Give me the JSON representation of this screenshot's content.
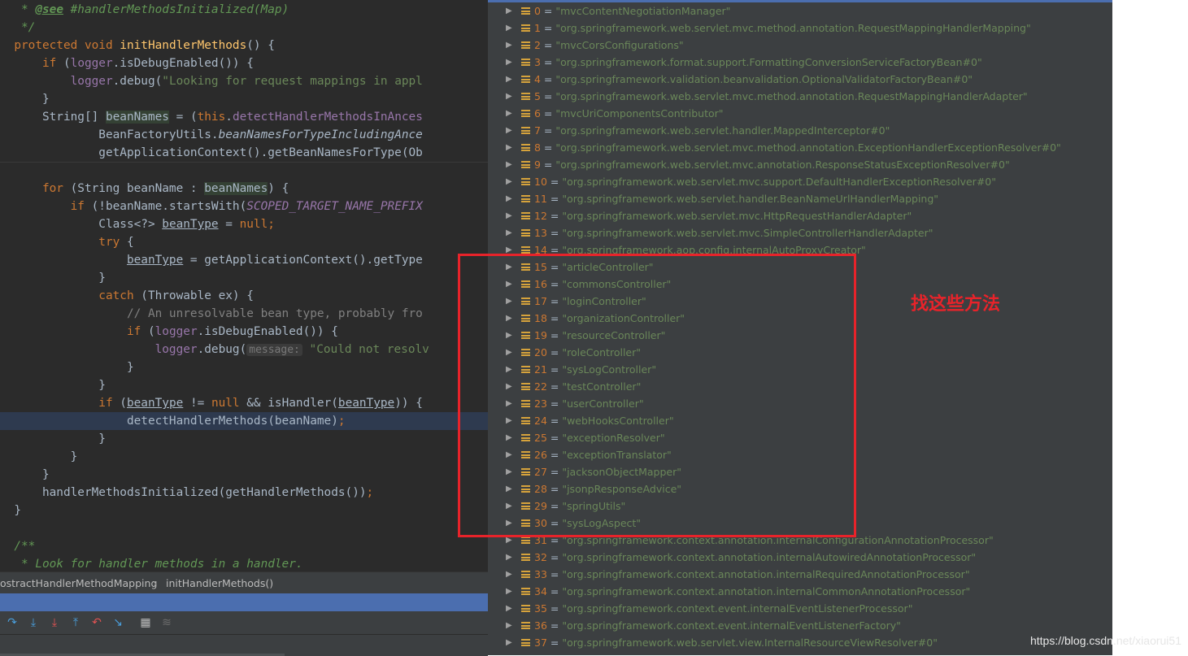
{
  "editor": {
    "lines": [
      [
        {
          "t": "   * ",
          "c": "c-doc"
        },
        {
          "t": "@see",
          "c": "c-doctag"
        },
        {
          "t": " #handlerMethodsInitialized(Map)",
          "c": "c-doc"
        }
      ],
      [
        {
          "t": "   */",
          "c": "c-doc"
        }
      ],
      [
        {
          "t": "  protected void ",
          "c": "c-kw"
        },
        {
          "t": "initHandlerMethods",
          "c": "c-fn"
        },
        {
          "t": "() {",
          "c": ""
        }
      ],
      [
        {
          "t": "      if ",
          "c": "c-kw"
        },
        {
          "t": "(",
          "c": ""
        },
        {
          "t": "logger",
          "c": "c-field"
        },
        {
          "t": ".isDebugEnabled()) {",
          "c": ""
        }
      ],
      [
        {
          "t": "          ",
          "c": ""
        },
        {
          "t": "logger",
          "c": "c-field"
        },
        {
          "t": ".debug(",
          "c": ""
        },
        {
          "t": "\"Looking for request mappings in appl",
          "c": "c-str"
        }
      ],
      [
        {
          "t": "      }",
          "c": ""
        }
      ],
      [
        {
          "t": "      String[] ",
          "c": ""
        },
        {
          "t": "beanNames",
          "c": "c-box"
        },
        {
          "t": " = (",
          "c": ""
        },
        {
          "t": "this",
          "c": "c-kw"
        },
        {
          "t": ".",
          "c": ""
        },
        {
          "t": "detectHandlerMethodsInAnces",
          "c": "c-field"
        }
      ],
      [
        {
          "t": "              BeanFactoryUtils.",
          "c": ""
        },
        {
          "t": "beanNamesForTypeIncludingAnce",
          "c": "c-static"
        }
      ],
      [
        {
          "t": "              getApplicationContext().getBeanNamesForType(Ob",
          "c": ""
        }
      ],
      [
        {
          "t": "",
          "c": ""
        }
      ],
      [
        {
          "t": "      for ",
          "c": "c-kw"
        },
        {
          "t": "(String beanName : ",
          "c": ""
        },
        {
          "t": "beanNames",
          "c": "c-box"
        },
        {
          "t": ") {",
          "c": ""
        }
      ],
      [
        {
          "t": "          if ",
          "c": "c-kw"
        },
        {
          "t": "(!beanName.startsWith(",
          "c": ""
        },
        {
          "t": "SCOPED_TARGET_NAME_PREFIX",
          "c": "c-const"
        }
      ],
      [
        {
          "t": "              Class<?> ",
          "c": ""
        },
        {
          "t": "beanType",
          "c": "c-ul"
        },
        {
          "t": " = ",
          "c": ""
        },
        {
          "t": "null",
          "c": "c-kw"
        },
        {
          "t": ";",
          "c": "c-kw"
        }
      ],
      [
        {
          "t": "              try ",
          "c": "c-kw"
        },
        {
          "t": "{",
          "c": ""
        }
      ],
      [
        {
          "t": "                  ",
          "c": ""
        },
        {
          "t": "beanType",
          "c": "c-ul"
        },
        {
          "t": " = getApplicationContext().getType",
          "c": ""
        }
      ],
      [
        {
          "t": "              }",
          "c": ""
        }
      ],
      [
        {
          "t": "              catch ",
          "c": "c-kw"
        },
        {
          "t": "(Throwable ex) {",
          "c": ""
        }
      ],
      [
        {
          "t": "                  // An unresolvable bean type, probably fro",
          "c": "c-cmt"
        }
      ],
      [
        {
          "t": "                  if ",
          "c": "c-kw"
        },
        {
          "t": "(",
          "c": ""
        },
        {
          "t": "logger",
          "c": "c-field"
        },
        {
          "t": ".isDebugEnabled()) {",
          "c": ""
        }
      ],
      [
        {
          "t": "                      ",
          "c": ""
        },
        {
          "t": "logger",
          "c": "c-field"
        },
        {
          "t": ".debug(",
          "c": ""
        },
        {
          "t": "message:",
          "c": "c-hint"
        },
        {
          "t": " \"Could not resolv",
          "c": "c-str"
        }
      ],
      [
        {
          "t": "                  }",
          "c": ""
        }
      ],
      [
        {
          "t": "              }",
          "c": ""
        }
      ],
      [
        {
          "t": "              if ",
          "c": "c-kw"
        },
        {
          "t": "(",
          "c": ""
        },
        {
          "t": "beanType",
          "c": "c-ul"
        },
        {
          "t": " != ",
          "c": ""
        },
        {
          "t": "null ",
          "c": "c-kw"
        },
        {
          "t": "&& isHandler(",
          "c": ""
        },
        {
          "t": "beanType",
          "c": "c-ul"
        },
        {
          "t": ")) {",
          "c": ""
        }
      ],
      [
        {
          "t": "                  detectHandlerMethods(beanName)",
          "c": ""
        },
        {
          "t": ";",
          "c": "c-kw"
        }
      ],
      [
        {
          "t": "              }",
          "c": ""
        }
      ],
      [
        {
          "t": "          }",
          "c": ""
        }
      ],
      [
        {
          "t": "      }",
          "c": ""
        }
      ],
      [
        {
          "t": "      handlerMethodsInitialized(getHandlerMethods())",
          "c": ""
        },
        {
          "t": ";",
          "c": "c-kw"
        }
      ],
      [
        {
          "t": "  }",
          "c": ""
        }
      ],
      [
        {
          "t": "",
          "c": ""
        }
      ],
      [
        {
          "t": "  /**",
          "c": "c-doc"
        }
      ],
      [
        {
          "t": "   * Look for handler methods in a handler.",
          "c": "c-doc"
        }
      ]
    ]
  },
  "breadcrumb": {
    "class_name": "ostractHandlerMethodMapping",
    "separator": "›",
    "method_name": "initHandlerMethods()"
  },
  "debug_toolbar": {
    "buttons": [
      {
        "icon": "step-over-icon",
        "glyph": "↷"
      },
      {
        "icon": "step-into-icon",
        "glyph": "⤓"
      },
      {
        "icon": "force-step-into-icon",
        "glyph": "⤓"
      },
      {
        "icon": "step-out-icon",
        "glyph": "⤒"
      },
      {
        "icon": "drop-frame-icon",
        "glyph": "↶"
      },
      {
        "icon": "run-to-cursor-icon",
        "glyph": "↘"
      },
      {
        "icon": "evaluate-expression-icon",
        "glyph": "▦"
      },
      {
        "icon": "trace-stream-icon",
        "glyph": "≋"
      }
    ]
  },
  "variables": [
    {
      "index": "0",
      "value": "\"mvcContentNegotiationManager\""
    },
    {
      "index": "1",
      "value": "\"org.springframework.web.servlet.mvc.method.annotation.RequestMappingHandlerMapping\""
    },
    {
      "index": "2",
      "value": "\"mvcCorsConfigurations\""
    },
    {
      "index": "3",
      "value": "\"org.springframework.format.support.FormattingConversionServiceFactoryBean#0\""
    },
    {
      "index": "4",
      "value": "\"org.springframework.validation.beanvalidation.OptionalValidatorFactoryBean#0\""
    },
    {
      "index": "5",
      "value": "\"org.springframework.web.servlet.mvc.method.annotation.RequestMappingHandlerAdapter\""
    },
    {
      "index": "6",
      "value": "\"mvcUriComponentsContributor\""
    },
    {
      "index": "7",
      "value": "\"org.springframework.web.servlet.handler.MappedInterceptor#0\""
    },
    {
      "index": "8",
      "value": "\"org.springframework.web.servlet.mvc.method.annotation.ExceptionHandlerExceptionResolver#0\""
    },
    {
      "index": "9",
      "value": "\"org.springframework.web.servlet.mvc.annotation.ResponseStatusExceptionResolver#0\""
    },
    {
      "index": "10",
      "value": "\"org.springframework.web.servlet.mvc.support.DefaultHandlerExceptionResolver#0\""
    },
    {
      "index": "11",
      "value": "\"org.springframework.web.servlet.handler.BeanNameUrlHandlerMapping\""
    },
    {
      "index": "12",
      "value": "\"org.springframework.web.servlet.mvc.HttpRequestHandlerAdapter\""
    },
    {
      "index": "13",
      "value": "\"org.springframework.web.servlet.mvc.SimpleControllerHandlerAdapter\""
    },
    {
      "index": "14",
      "value": "\"org.springframework.aop.config.internalAutoProxyCreator\""
    },
    {
      "index": "15",
      "value": "\"articleController\""
    },
    {
      "index": "16",
      "value": "\"commonsController\""
    },
    {
      "index": "17",
      "value": "\"loginController\""
    },
    {
      "index": "18",
      "value": "\"organizationController\""
    },
    {
      "index": "19",
      "value": "\"resourceController\""
    },
    {
      "index": "20",
      "value": "\"roleController\""
    },
    {
      "index": "21",
      "value": "\"sysLogController\""
    },
    {
      "index": "22",
      "value": "\"testController\""
    },
    {
      "index": "23",
      "value": "\"userController\""
    },
    {
      "index": "24",
      "value": "\"webHooksController\""
    },
    {
      "index": "25",
      "value": "\"exceptionResolver\""
    },
    {
      "index": "26",
      "value": "\"exceptionTranslator\""
    },
    {
      "index": "27",
      "value": "\"jacksonObjectMapper\""
    },
    {
      "index": "28",
      "value": "\"jsonpResponseAdvice\""
    },
    {
      "index": "29",
      "value": "\"springUtils\""
    },
    {
      "index": "30",
      "value": "\"sysLogAspect\""
    },
    {
      "index": "31",
      "value": "\"org.springframework.context.annotation.internalConfigurationAnnotationProcessor\""
    },
    {
      "index": "32",
      "value": "\"org.springframework.context.annotation.internalAutowiredAnnotationProcessor\""
    },
    {
      "index": "33",
      "value": "\"org.springframework.context.annotation.internalRequiredAnnotationProcessor\""
    },
    {
      "index": "34",
      "value": "\"org.springframework.context.annotation.internalCommonAnnotationProcessor\""
    },
    {
      "index": "35",
      "value": "\"org.springframework.context.event.internalEventListenerProcessor\""
    },
    {
      "index": "36",
      "value": "\"org.springframework.context.event.internalEventListenerFactory\""
    },
    {
      "index": "37",
      "value": "\"org.springframework.web.servlet.view.InternalResourceViewResolver#0\""
    }
  ],
  "annotation": {
    "text": "找这些方法",
    "color": "#e8232a"
  },
  "watermark": "https://blog.csdn.net/xiaorui51",
  "colors": {
    "editor_bg": "#2b2b2b",
    "panel_bg": "#3c3f41",
    "keyword": "#cc7832",
    "string": "#6a8759",
    "accent_blue": "#4b6eaf"
  }
}
